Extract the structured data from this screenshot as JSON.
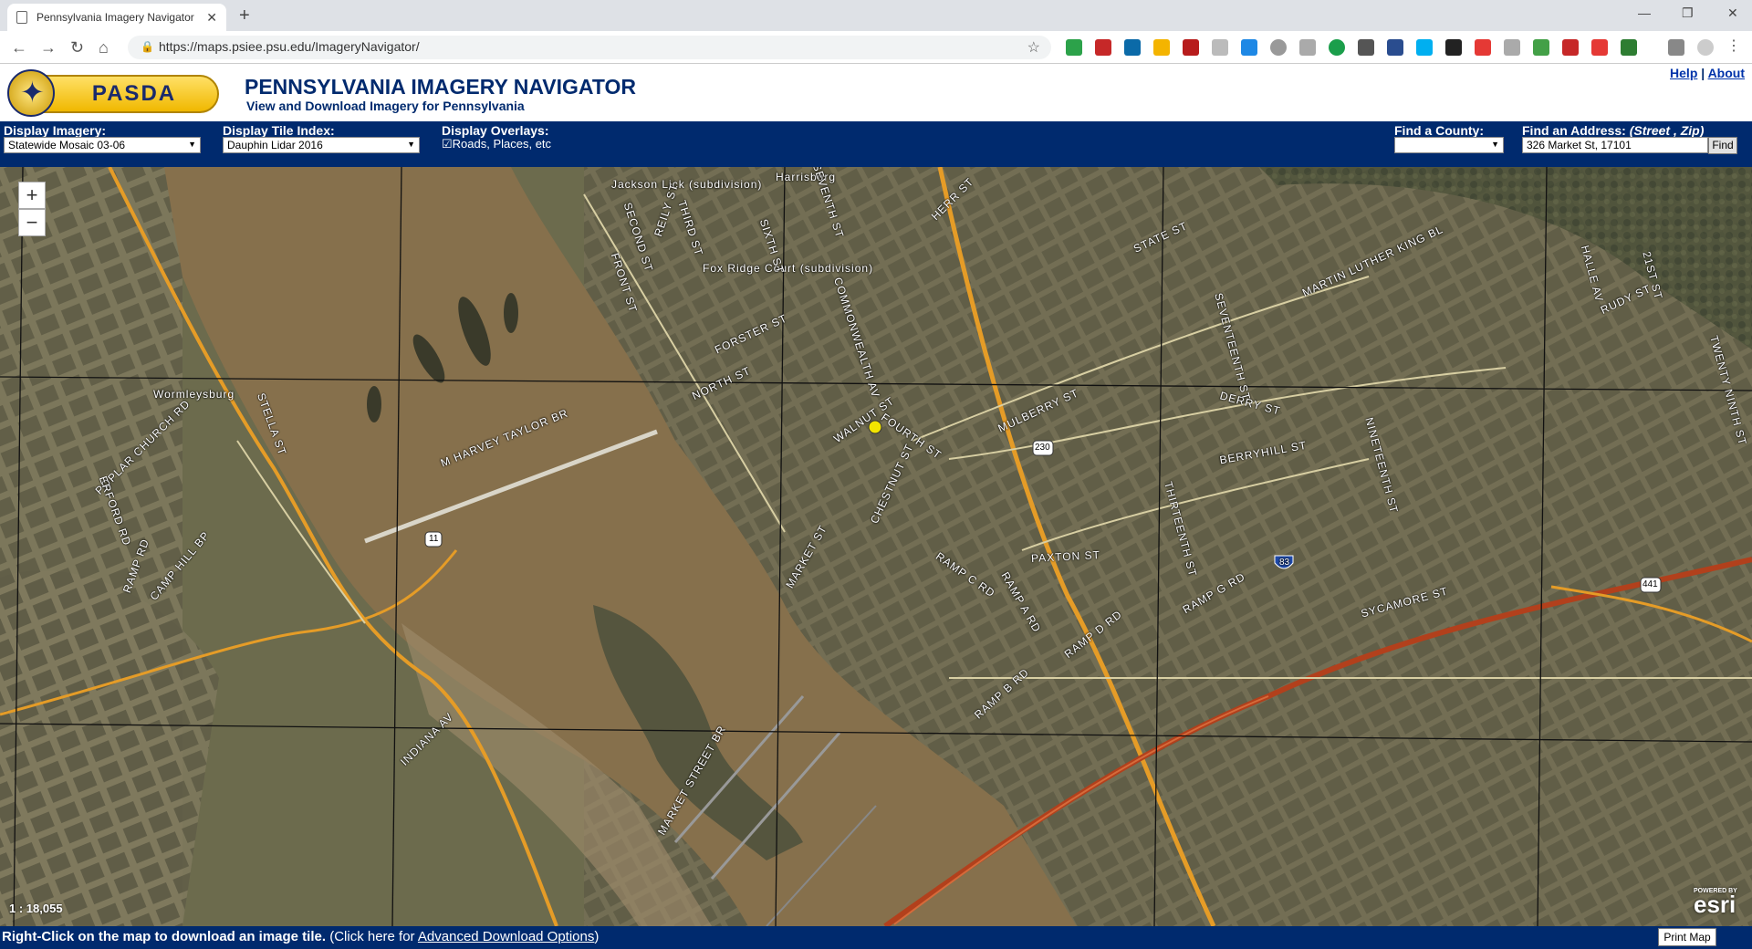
{
  "browser": {
    "tab_title": "Pennsylvania Imagery Navigator",
    "url": "https://maps.psiee.psu.edu/ImageryNavigator/"
  },
  "header": {
    "logo_text": "PASDA",
    "title": "PENNSYLVANIA IMAGERY NAVIGATOR",
    "subtitle": "View and Download Imagery for Pennsylvania",
    "help": "Help",
    "separator": "|",
    "about": "About"
  },
  "controls": {
    "display_imagery_label": "Display Imagery:",
    "display_imagery_value": "Statewide Mosaic 03-06",
    "tile_index_label": "Display Tile Index:",
    "tile_index_value": "Dauphin Lidar 2016",
    "overlays_label": "Display Overlays:",
    "overlays_checkbox": "Roads, Places, etc",
    "county_label": "Find a County:",
    "county_value": "",
    "address_label": "Find an Address:",
    "address_hint": "(Street , Zip)",
    "address_value": "326 Market St, 17101",
    "find_button": "Find"
  },
  "map": {
    "zoom_in": "+",
    "zoom_out": "−",
    "scale": "1 : 18,055",
    "attribution_small": "POWERED BY",
    "attribution": "esri",
    "labels": {
      "harrisburg": "Harrisburg",
      "jackson_lick": "Jackson Lick (subdivision)",
      "fox_ridge": "Fox Ridge Court (subdivision)",
      "wormleysburg": "Wormleysburg",
      "harvey_taylor": "M HARVEY TAYLOR BR",
      "market_street_br": "MARKET STREET BR",
      "front_st": "FRONT ST",
      "second_st": "SECOND ST",
      "third_st": "THIRD ST",
      "sixth_st": "SIXTH ST",
      "seventh_st": "SEVENTH ST",
      "forster_st": "FORSTER ST",
      "north_st": "NORTH ST",
      "commonwealth_av": "COMMONWEALTH AV",
      "walnut_st": "WALNUT ST",
      "fourth_st": "FOURTH ST",
      "chestnut_st": "CHESTNUT ST",
      "market_st": "MARKET ST",
      "mulberry_st": "MULBERRY ST",
      "derry_st": "DERRY ST",
      "berryhill_st": "BERRYHILL ST",
      "paxton_st": "PAXTON ST",
      "state_st": "STATE ST",
      "herr_st": "HERR ST",
      "reily_st": "REILY ST",
      "mlk": "MARTIN LUTHER KING BL",
      "seventeenth_st": "SEVENTEENTH ST",
      "nineteenth_st": "NINETEENTH ST",
      "thirteenth_st": "THIRTEENTH ST",
      "sycamore_st": "SYCAMORE ST",
      "ramp_c": "RAMP C RD",
      "ramp_a": "RAMP A RD",
      "ramp_b": "RAMP B RD",
      "ramp_d": "RAMP D RD",
      "ramp_g": "RAMP G RD",
      "poplar_church": "POPLAR CHURCH RD",
      "erford": "ERFORD RD",
      "camp_hill": "CAMP HILL BP",
      "ramp_rd": "RAMP RD",
      "indiana_av": "INDIANA AV",
      "stella": "STELLA ST",
      "halle": "HALLE AV",
      "rudy": "RUDY ST",
      "twentyfirst": "21ST ST",
      "twentyninth": "TWENTY NINTH ST",
      "route_11": "11",
      "route_230": "230",
      "route_83": "83",
      "route_441": "441"
    }
  },
  "footer": {
    "bold_text": "Right-Click on the map to download an image tile.",
    "plain_text": " (Click here for ",
    "link_text": "Advanced Download Options",
    "close_paren": ")",
    "print_button": "Print Map"
  }
}
